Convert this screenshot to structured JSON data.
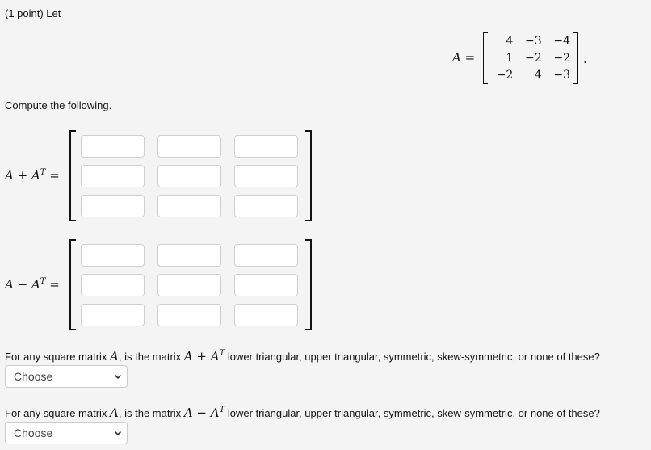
{
  "problem": {
    "points_label": "(1 point) Let",
    "given_matrix": {
      "name": "A",
      "equals": "=",
      "rows": [
        [
          "4",
          "−3",
          "−4"
        ],
        [
          "1",
          "−2",
          "−2"
        ],
        [
          "−2",
          "4",
          "−3"
        ]
      ],
      "trailing": "."
    },
    "compute_label": "Compute the following."
  },
  "answers": [
    {
      "label_parts": {
        "a": "A",
        "op": " + ",
        "b": "A",
        "sup": "T",
        "eq": " ="
      },
      "cells": [
        [
          "",
          "",
          ""
        ],
        [
          "",
          "",
          ""
        ],
        [
          "",
          "",
          ""
        ]
      ]
    },
    {
      "label_parts": {
        "a": "A",
        "op": " − ",
        "b": "A",
        "sup": "T",
        "eq": " ="
      },
      "cells": [
        [
          "",
          "",
          ""
        ],
        [
          "",
          "",
          ""
        ],
        [
          "",
          "",
          ""
        ]
      ]
    }
  ],
  "questions": [
    {
      "prefix": "For any square matrix ",
      "var": "A",
      "mid": ", is the matrix ",
      "expr_a": "A",
      "expr_op": " + ",
      "expr_b": "A",
      "expr_sup": "T",
      "suffix": " lower triangular, upper triangular, symmetric, skew-symmetric, or none of these?",
      "select_value": "Choose"
    },
    {
      "prefix": "For any square matrix ",
      "var": "A",
      "mid": ", is the matrix ",
      "expr_a": "A",
      "expr_op": " − ",
      "expr_b": "A",
      "expr_sup": "T",
      "suffix": " lower triangular, upper triangular, symmetric, skew-symmetric, or none of these?",
      "select_value": "Choose"
    }
  ]
}
